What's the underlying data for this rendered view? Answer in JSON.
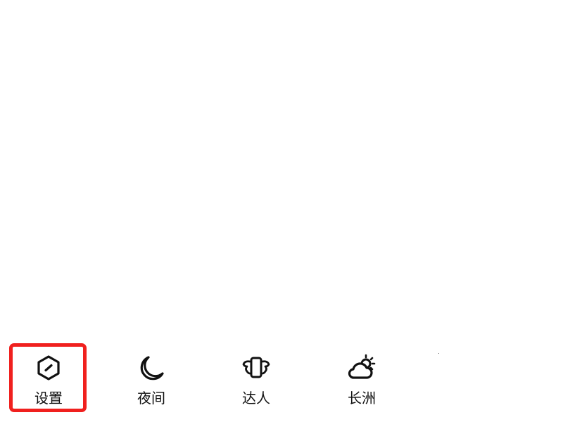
{
  "bottom_nav": {
    "items": [
      {
        "label": "设置",
        "icon": "hexagon-settings-icon",
        "highlighted": true
      },
      {
        "label": "夜间",
        "icon": "crescent-moon-icon",
        "highlighted": false
      },
      {
        "label": "达人",
        "icon": "winged-phone-icon",
        "highlighted": false
      },
      {
        "label": "长洲",
        "icon": "sun-cloud-weather-icon",
        "highlighted": false
      }
    ]
  },
  "colors": {
    "highlight_border": "#f0201e",
    "icon_stroke": "#111111",
    "label_text": "#111111",
    "background": "#ffffff"
  }
}
